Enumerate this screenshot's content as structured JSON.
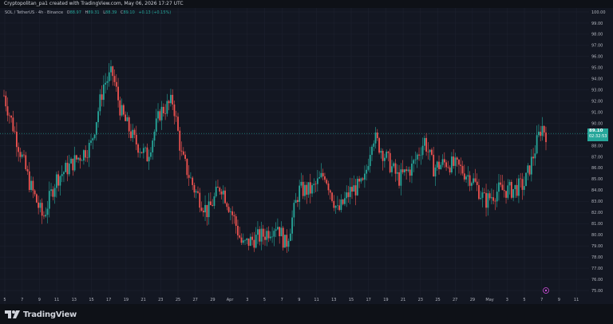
{
  "header": {
    "text": "Cryptopolitan_pa1 created with TradingView.com, May 06, 2026 17:27 UTC"
  },
  "legend": {
    "symbol": "SOL / TetherUS · 4h · Binance",
    "open_label": "O",
    "open": "88.97",
    "high_label": "H",
    "high": "89.31",
    "low_label": "L",
    "low": "88.39",
    "close_label": "C",
    "close": "89.10",
    "change": "+0.13 (+0.15%)"
  },
  "last_price": {
    "price": "89.10",
    "countdown": "02:32:53"
  },
  "brand": {
    "name": "TradingView"
  },
  "colors": {
    "background": "#131722",
    "up": "#26a69a",
    "down": "#ef5350",
    "grid": "#1f2331",
    "axis_text": "#b2b5be"
  },
  "icons": {
    "logo": "tradingview-logo-icon",
    "marker": "event-marker-icon"
  },
  "chart_data": {
    "type": "candlestick",
    "title": "SOL / TetherUS · 4h · Binance",
    "ylim": [
      75,
      100
    ],
    "y_ticks": [
      "75.00",
      "76.00",
      "77.00",
      "78.00",
      "79.00",
      "80.00",
      "81.00",
      "82.00",
      "83.00",
      "84.00",
      "85.00",
      "86.00",
      "87.00",
      "88.00",
      "89.00",
      "90.00",
      "91.00",
      "92.00",
      "93.00",
      "94.00",
      "95.00",
      "96.00",
      "97.00",
      "98.00",
      "99.00",
      "100.00"
    ],
    "x_ticks": [
      "5",
      "7",
      "9",
      "11",
      "13",
      "15",
      "17",
      "19",
      "21",
      "23",
      "25",
      "27",
      "29",
      "Apr",
      "3",
      "5",
      "7",
      "9",
      "11",
      "13",
      "15",
      "17",
      "19",
      "21",
      "23",
      "25",
      "27",
      "29",
      "May",
      "3",
      "5",
      "7",
      "9",
      "11"
    ],
    "price_line": 89.1,
    "grid": true,
    "anchors": [
      {
        "t": 0,
        "p": 92.5
      },
      {
        "t": 1.5,
        "p": 88.5
      },
      {
        "t": 3,
        "p": 84.5
      },
      {
        "t": 4.5,
        "p": 81.5
      },
      {
        "t": 6,
        "p": 85.0
      },
      {
        "t": 8,
        "p": 86.5
      },
      {
        "t": 10,
        "p": 88.0
      },
      {
        "t": 11.5,
        "p": 93.5
      },
      {
        "t": 12.5,
        "p": 94.5
      },
      {
        "t": 13.5,
        "p": 91.0
      },
      {
        "t": 15,
        "p": 88.5
      },
      {
        "t": 16.5,
        "p": 87.0
      },
      {
        "t": 18,
        "p": 91.0
      },
      {
        "t": 19.5,
        "p": 92.0
      },
      {
        "t": 20.5,
        "p": 87.0
      },
      {
        "t": 22,
        "p": 84.0
      },
      {
        "t": 23.5,
        "p": 82.0
      },
      {
        "t": 25,
        "p": 84.5
      },
      {
        "t": 26.5,
        "p": 81.5
      },
      {
        "t": 27.5,
        "p": 79.0
      },
      {
        "t": 28.5,
        "p": 79.5
      },
      {
        "t": 30,
        "p": 80.0
      },
      {
        "t": 31.5,
        "p": 81.0
      },
      {
        "t": 32.5,
        "p": 79.0
      },
      {
        "t": 34,
        "p": 84.0
      },
      {
        "t": 35.5,
        "p": 84.0
      },
      {
        "t": 37,
        "p": 85.5
      },
      {
        "t": 38.5,
        "p": 82.0
      },
      {
        "t": 40,
        "p": 84.0
      },
      {
        "t": 41.5,
        "p": 84.5
      },
      {
        "t": 42.5,
        "p": 89.0
      },
      {
        "t": 44,
        "p": 87.0
      },
      {
        "t": 45.5,
        "p": 85.0
      },
      {
        "t": 47,
        "p": 86.0
      },
      {
        "t": 48.5,
        "p": 88.5
      },
      {
        "t": 49.5,
        "p": 86.0
      },
      {
        "t": 51,
        "p": 86.5
      },
      {
        "t": 52.5,
        "p": 86.0
      },
      {
        "t": 54,
        "p": 85.0
      },
      {
        "t": 55.5,
        "p": 83.0
      },
      {
        "t": 57,
        "p": 84.0
      },
      {
        "t": 58.5,
        "p": 84.0
      },
      {
        "t": 60,
        "p": 84.5
      },
      {
        "t": 61,
        "p": 87.0
      },
      {
        "t": 62,
        "p": 89.8
      },
      {
        "t": 62.5,
        "p": 89.1
      }
    ]
  }
}
